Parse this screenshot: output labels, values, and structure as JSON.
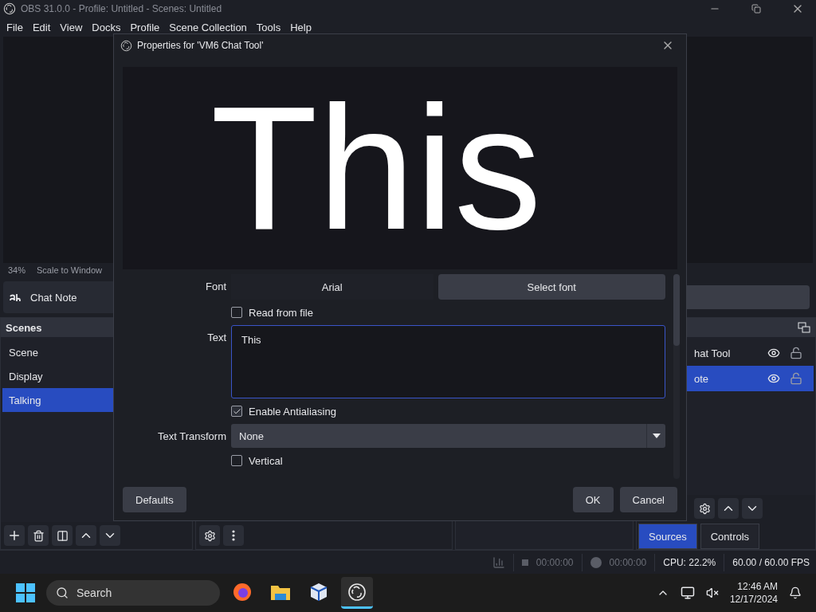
{
  "window": {
    "title": "OBS 31.0.0 - Profile: Untitled - Scenes: Untitled"
  },
  "menu": [
    "File",
    "Edit",
    "View",
    "Docks",
    "Profile",
    "Scene Collection",
    "Tools",
    "Help"
  ],
  "preview_bar": {
    "zoom": "34%",
    "scale": "Scale to Window"
  },
  "context_bar": {
    "source": "Chat Note"
  },
  "scenes": {
    "title": "Scenes",
    "items": [
      {
        "label": "Scene",
        "selected": false
      },
      {
        "label": "Display",
        "selected": false
      },
      {
        "label": "Talking",
        "selected": true
      }
    ]
  },
  "sources": {
    "items": [
      {
        "label": "hat Tool",
        "selected": false,
        "visible": true,
        "locked": false
      },
      {
        "label": "ote",
        "selected": true,
        "visible": true,
        "locked": false
      }
    ]
  },
  "dock_tabs": [
    {
      "label": "Sources",
      "selected": true
    },
    {
      "label": "Controls",
      "selected": false
    }
  ],
  "dialog": {
    "title": "Properties for 'VM6 Chat Tool'",
    "preview_text": "This",
    "properties": [
      {
        "kind": "font",
        "label": "Font",
        "value": "Arial",
        "button": "Select font"
      },
      {
        "kind": "checkbox",
        "label": "Read from file",
        "checked": false
      },
      {
        "kind": "textarea",
        "label": "Text",
        "value": "This"
      },
      {
        "kind": "checkbox",
        "label": "Enable Antialiasing",
        "checked": true
      },
      {
        "kind": "select",
        "label": "Text Transform",
        "value": "None"
      },
      {
        "kind": "checkbox",
        "label": "Vertical",
        "checked": false
      }
    ],
    "buttons": {
      "defaults": "Defaults",
      "ok": "OK",
      "cancel": "Cancel"
    }
  },
  "status_bar": {
    "stream_time": "00:00:00",
    "record_time": "00:00:00",
    "cpu": "CPU: 22.2%",
    "fps": "60.00 / 60.00 FPS"
  },
  "taskbar": {
    "search": {
      "placeholder": "Search"
    },
    "apps": [
      {
        "kind": "browser",
        "selected": false
      },
      {
        "kind": "folder",
        "selected": false
      },
      {
        "kind": "cube",
        "selected": false
      },
      {
        "kind": "obs",
        "selected": true
      }
    ],
    "time": "12:46 AM",
    "date": "12/17/2024"
  }
}
